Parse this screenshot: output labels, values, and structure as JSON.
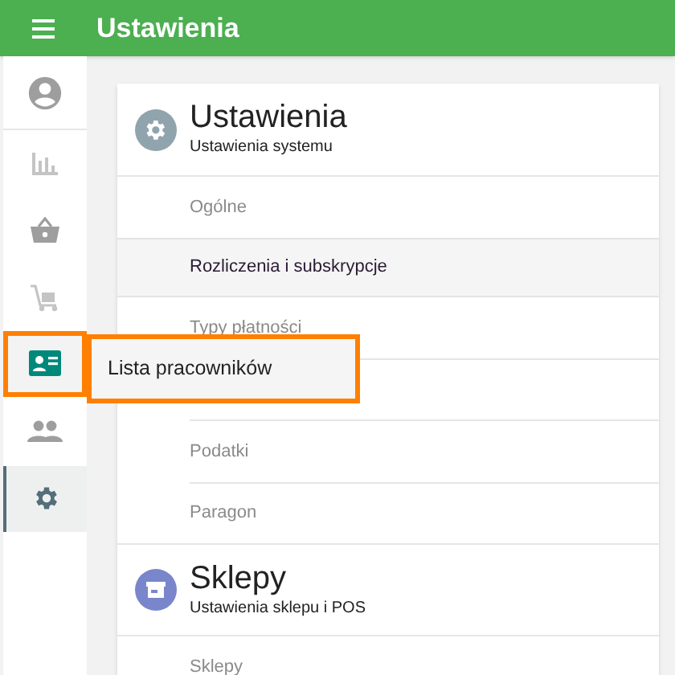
{
  "app_bar": {
    "title": "Ustawienia"
  },
  "nav": [
    {
      "kind": "avatar",
      "selected": false,
      "highlighted": false
    },
    {
      "kind": "chart",
      "selected": false,
      "highlighted": false
    },
    {
      "kind": "basket",
      "selected": false,
      "highlighted": false
    },
    {
      "kind": "cart",
      "selected": false,
      "highlighted": false
    },
    {
      "kind": "id-card",
      "selected": false,
      "highlighted": true
    },
    {
      "kind": "people",
      "selected": false,
      "highlighted": false
    },
    {
      "kind": "gear",
      "selected": true,
      "highlighted": false
    }
  ],
  "tooltip": {
    "text": "Lista pracowników",
    "highlighted": true
  },
  "sections": [
    {
      "kind": "settings",
      "title": "Ustawienia",
      "subtitle": "Ustawienia systemu",
      "items": [
        {
          "label": "Ogólne",
          "selected": false
        },
        {
          "label": "Rozliczenia i subskrypcje",
          "selected": true
        },
        {
          "label": "Typy płatności",
          "selected": false
        },
        {
          "selected": false
        },
        {
          "label": "Podatki",
          "selected": false
        },
        {
          "label": "Paragon",
          "selected": false
        }
      ]
    },
    {
      "kind": "store",
      "title": "Sklepy",
      "subtitle": "Ustawienia sklepu i POS",
      "items": [
        {
          "label": "Sklepy",
          "selected": false
        }
      ]
    }
  ]
}
